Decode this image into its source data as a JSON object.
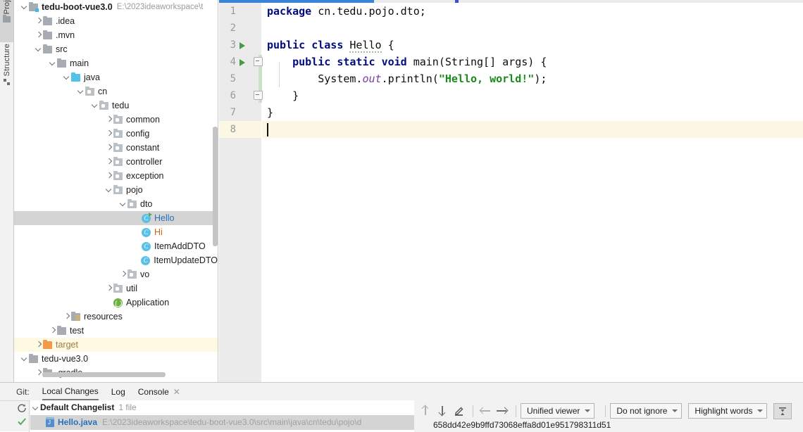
{
  "toolstrip": {
    "buttons": [
      {
        "label": "Proj",
        "icon": "project-icon",
        "active": true
      },
      {
        "label": "Structure",
        "icon": "structure-icon",
        "active": false
      }
    ]
  },
  "project_tree": {
    "rows": [
      {
        "indent": 0,
        "arrow": "down",
        "icon": "module-icon",
        "label": "tedu-boot-vue3.0",
        "style": "bold",
        "path": "E:\\2023ideaworkspace\\t"
      },
      {
        "indent": 1,
        "arrow": "right",
        "icon": "folder-icon",
        "label": ".idea",
        "style": "normal"
      },
      {
        "indent": 1,
        "arrow": "right",
        "icon": "folder-icon",
        "label": ".mvn",
        "style": "normal"
      },
      {
        "indent": 1,
        "arrow": "down",
        "icon": "folder-icon",
        "label": "src",
        "style": "normal"
      },
      {
        "indent": 2,
        "arrow": "down",
        "icon": "folder-icon",
        "label": "main",
        "style": "normal"
      },
      {
        "indent": 3,
        "arrow": "down",
        "icon": "source-folder-icon",
        "label": "java",
        "style": "normal"
      },
      {
        "indent": 4,
        "arrow": "down",
        "icon": "package-icon",
        "label": "cn",
        "style": "normal"
      },
      {
        "indent": 5,
        "arrow": "down",
        "icon": "package-icon",
        "label": "tedu",
        "style": "normal"
      },
      {
        "indent": 6,
        "arrow": "right",
        "icon": "package-icon",
        "label": "common",
        "style": "normal"
      },
      {
        "indent": 6,
        "arrow": "right",
        "icon": "package-icon",
        "label": "config",
        "style": "normal"
      },
      {
        "indent": 6,
        "arrow": "right",
        "icon": "package-icon",
        "label": "constant",
        "style": "normal"
      },
      {
        "indent": 6,
        "arrow": "right",
        "icon": "package-icon",
        "label": "controller",
        "style": "normal"
      },
      {
        "indent": 6,
        "arrow": "right",
        "icon": "package-icon",
        "label": "exception",
        "style": "normal"
      },
      {
        "indent": 6,
        "arrow": "down",
        "icon": "package-icon",
        "label": "pojo",
        "style": "normal"
      },
      {
        "indent": 7,
        "arrow": "down",
        "icon": "package-icon",
        "label": "dto",
        "style": "normal"
      },
      {
        "indent": 8,
        "arrow": "none",
        "icon": "class-runnable-icon",
        "label": "Hello",
        "style": "selected",
        "selected": true
      },
      {
        "indent": 8,
        "arrow": "none",
        "icon": "class-icon",
        "label": "Hi",
        "style": "modified"
      },
      {
        "indent": 8,
        "arrow": "none",
        "icon": "class-icon",
        "label": "ItemAddDTO",
        "style": "normal"
      },
      {
        "indent": 8,
        "arrow": "none",
        "icon": "class-icon",
        "label": "ItemUpdateDTO",
        "style": "normal"
      },
      {
        "indent": 7,
        "arrow": "right",
        "icon": "package-icon",
        "label": "vo",
        "style": "normal"
      },
      {
        "indent": 6,
        "arrow": "right",
        "icon": "package-icon",
        "label": "util",
        "style": "normal"
      },
      {
        "indent": 6,
        "arrow": "none",
        "icon": "spring-app-icon",
        "label": "Application",
        "style": "normal"
      },
      {
        "indent": 3,
        "arrow": "right",
        "icon": "resources-folder-icon",
        "label": "resources",
        "style": "normal"
      },
      {
        "indent": 2,
        "arrow": "right",
        "icon": "folder-icon",
        "label": "test",
        "style": "normal"
      },
      {
        "indent": 1,
        "arrow": "right",
        "icon": "excluded-folder-icon",
        "label": "target",
        "style": "excluded",
        "rowbg": "warn"
      },
      {
        "indent": 0,
        "arrow": "down",
        "icon": "folder-icon",
        "label": "tedu-vue3.0",
        "style": "normal"
      },
      {
        "indent": 1,
        "arrow": "right",
        "icon": "folder-icon",
        "label": ".gradle",
        "style": "normal"
      }
    ]
  },
  "editor": {
    "filename": "Hello.java",
    "lines": [
      {
        "n": "1",
        "run": false,
        "changed": false,
        "caret": false
      },
      {
        "n": "2",
        "run": false,
        "changed": false,
        "caret": false
      },
      {
        "n": "3",
        "run": true,
        "changed": false,
        "caret": false
      },
      {
        "n": "4",
        "run": true,
        "changed": true,
        "caret": false
      },
      {
        "n": "5",
        "run": false,
        "changed": true,
        "caret": false
      },
      {
        "n": "6",
        "run": false,
        "changed": true,
        "caret": false
      },
      {
        "n": "7",
        "run": false,
        "changed": false,
        "caret": false
      },
      {
        "n": "8",
        "run": false,
        "changed": false,
        "caret": true
      }
    ],
    "code": {
      "l1_kw_package": "package",
      "l1_pkg": " cn.tedu.pojo.dto;",
      "l3_kw_public": "public",
      "l3_kw_class": "class",
      "l3_name": "Hello",
      "l3_brace": " {",
      "l4_indent": "    ",
      "l4_kw_public": "public",
      "l4_kw_static": "static",
      "l4_kw_void": "void",
      "l4_sig": " main(String[] args) {",
      "l5_indent": "        ",
      "l5_sys": "System.",
      "l5_out": "out",
      "l5_println": ".println(",
      "l5_string": "\"Hello, world!\"",
      "l5_end": ");",
      "l6": "    }",
      "l7": "}"
    }
  },
  "git_panel": {
    "title": "Git:",
    "tabs": [
      {
        "label": "Local Changes",
        "active": true,
        "closable": false
      },
      {
        "label": "Log",
        "active": false,
        "closable": false
      },
      {
        "label": "Console",
        "active": false,
        "closable": true
      }
    ],
    "side_icons": [
      "refresh-icon",
      "checkmark-icon"
    ],
    "changelist": {
      "name": "Default Changelist",
      "count": "1 file",
      "files": [
        {
          "name": "Hello.java",
          "path": "E:\\2023ideaworkspace\\tedu-boot-vue3.0\\src\\main\\java\\cn\\tedu\\pojo\\d",
          "icon": "java-file-icon",
          "selected": true
        }
      ]
    },
    "diff_toolbar": {
      "icons": [
        "previous-difference-icon",
        "next-difference-icon",
        "edit-source-icon",
        "back-icon",
        "forward-icon"
      ],
      "combos": [
        {
          "name": "viewer-mode",
          "value": "Unified viewer"
        },
        {
          "name": "ignore-policy",
          "value": "Do not ignore"
        },
        {
          "name": "highlight-policy",
          "value": "Highlight words"
        }
      ],
      "collapse_button": "collapse-unchanged-icon",
      "revision_hash": "658dd42e9b9ffd73068effa8d01e951798311d51"
    }
  },
  "colors": {
    "accent_blue": "#3a84d8",
    "keyword": "#000b80",
    "string": "#1a8a1a",
    "static_field": "#7a3ea0",
    "selection": "#d4d4d4",
    "caret_line": "#fdf8e3",
    "changed_gutter": "#c9e4c4",
    "modified_file": "#c8641e",
    "excluded": "#9c7d3e",
    "link_blue": "#2a6fbb"
  }
}
